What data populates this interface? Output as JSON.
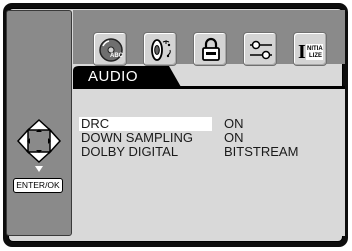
{
  "menu": {
    "active_tab": "AUDIO",
    "icons": [
      "disc-abc-icon",
      "speaker-sound-icon",
      "lock-icon",
      "equalizer-sliders-icon",
      "initialize-icon"
    ],
    "initialize_icon_text": "NITIA\nLIZE"
  },
  "audio_settings": [
    {
      "name": "DRC",
      "value": "ON",
      "selected": true
    },
    {
      "name": "DOWN SAMPLING",
      "value": "ON",
      "selected": false
    },
    {
      "name": "DOLBY DIGITAL",
      "value": "BITSTREAM",
      "selected": false
    }
  ],
  "controls": {
    "enter_label": "ENTER/OK"
  }
}
